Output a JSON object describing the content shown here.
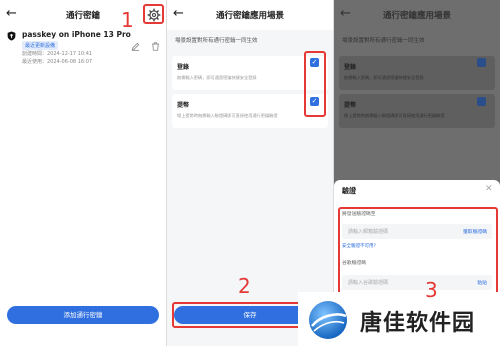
{
  "screen1": {
    "title": "通行密鑰",
    "passkey_name": "passkey on iPhone 13 Pro",
    "badge": "最近更新設備",
    "created": "創建時間：2024-12-17 10:41",
    "last_used": "最近使用：2024-06-08 16:07",
    "add_button": "添加通行密鑰"
  },
  "screen2": {
    "title": "通行密鑰應用場景",
    "description": "場景設置對所有通行密鑰一同生效",
    "items": [
      {
        "label": "登錄",
        "desc": "無需輸入密碼，即可通過密鑰快捷安全登錄",
        "checked": true
      },
      {
        "label": "提幣",
        "desc": "線上提幣時無需輸入驗證碼即可直接使用通行密鑰驗證",
        "checked": true
      }
    ],
    "save_button": "保存"
  },
  "screen3": {
    "title": "通行密鑰應用場景",
    "description": "場景設置對所有通行密鑰一同生效",
    "items": [
      {
        "label": "登錄",
        "desc": "無需輸入密碼，即可通過密鑰快捷安全登錄"
      },
      {
        "label": "提幣",
        "desc": "線上提幣時無需輸入驗證碼即可直接使用通行密鑰驗證"
      }
    ],
    "sheet": {
      "title": "驗證",
      "email_label": "將發送驗證碼至",
      "email_placeholder": "請輸入郵箱驗證碼",
      "email_action": "獲取驗證碼",
      "unavailable_link": "安全驗證不可用?",
      "ga_label": "谷歌驗證碼",
      "ga_placeholder": "請輸入谷歌驗證碼",
      "ga_action": "粘貼"
    }
  },
  "annotations": {
    "step1": "1",
    "step2": "2",
    "step3": "3"
  },
  "watermark": {
    "text": "唐佳软件园"
  },
  "colors": {
    "accent": "#2f6fe0",
    "annotation_red": "#e53935",
    "overlay": "#6e6e6e"
  }
}
